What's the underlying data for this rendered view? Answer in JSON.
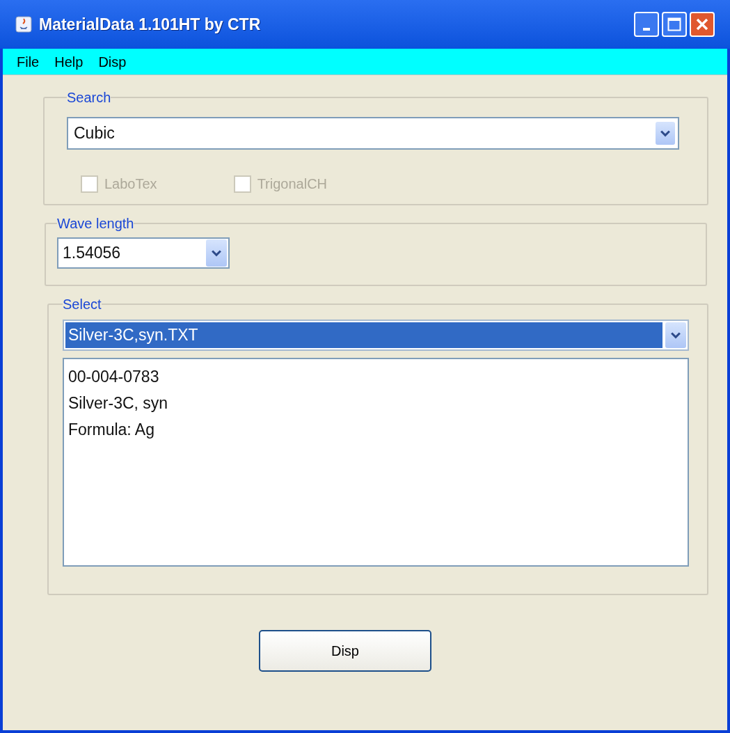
{
  "window": {
    "title": "MaterialData 1.101HT by CTR"
  },
  "menu": [
    "File",
    "Help",
    "Disp"
  ],
  "search": {
    "label": "Search",
    "value": "Cubic",
    "options": [
      {
        "label": "LaboTex",
        "checked": false,
        "disabled": true
      },
      {
        "label": "TrigonalCH",
        "checked": false,
        "disabled": true
      }
    ]
  },
  "wave_length": {
    "label": "Wave length",
    "value": "1.54056"
  },
  "select": {
    "label": "Select",
    "value": "Silver-3C,syn.TXT",
    "selected": true,
    "details": [
      "00-004-0783",
      "Silver-3C, syn",
      "Formula: Ag"
    ]
  },
  "button": "Disp"
}
